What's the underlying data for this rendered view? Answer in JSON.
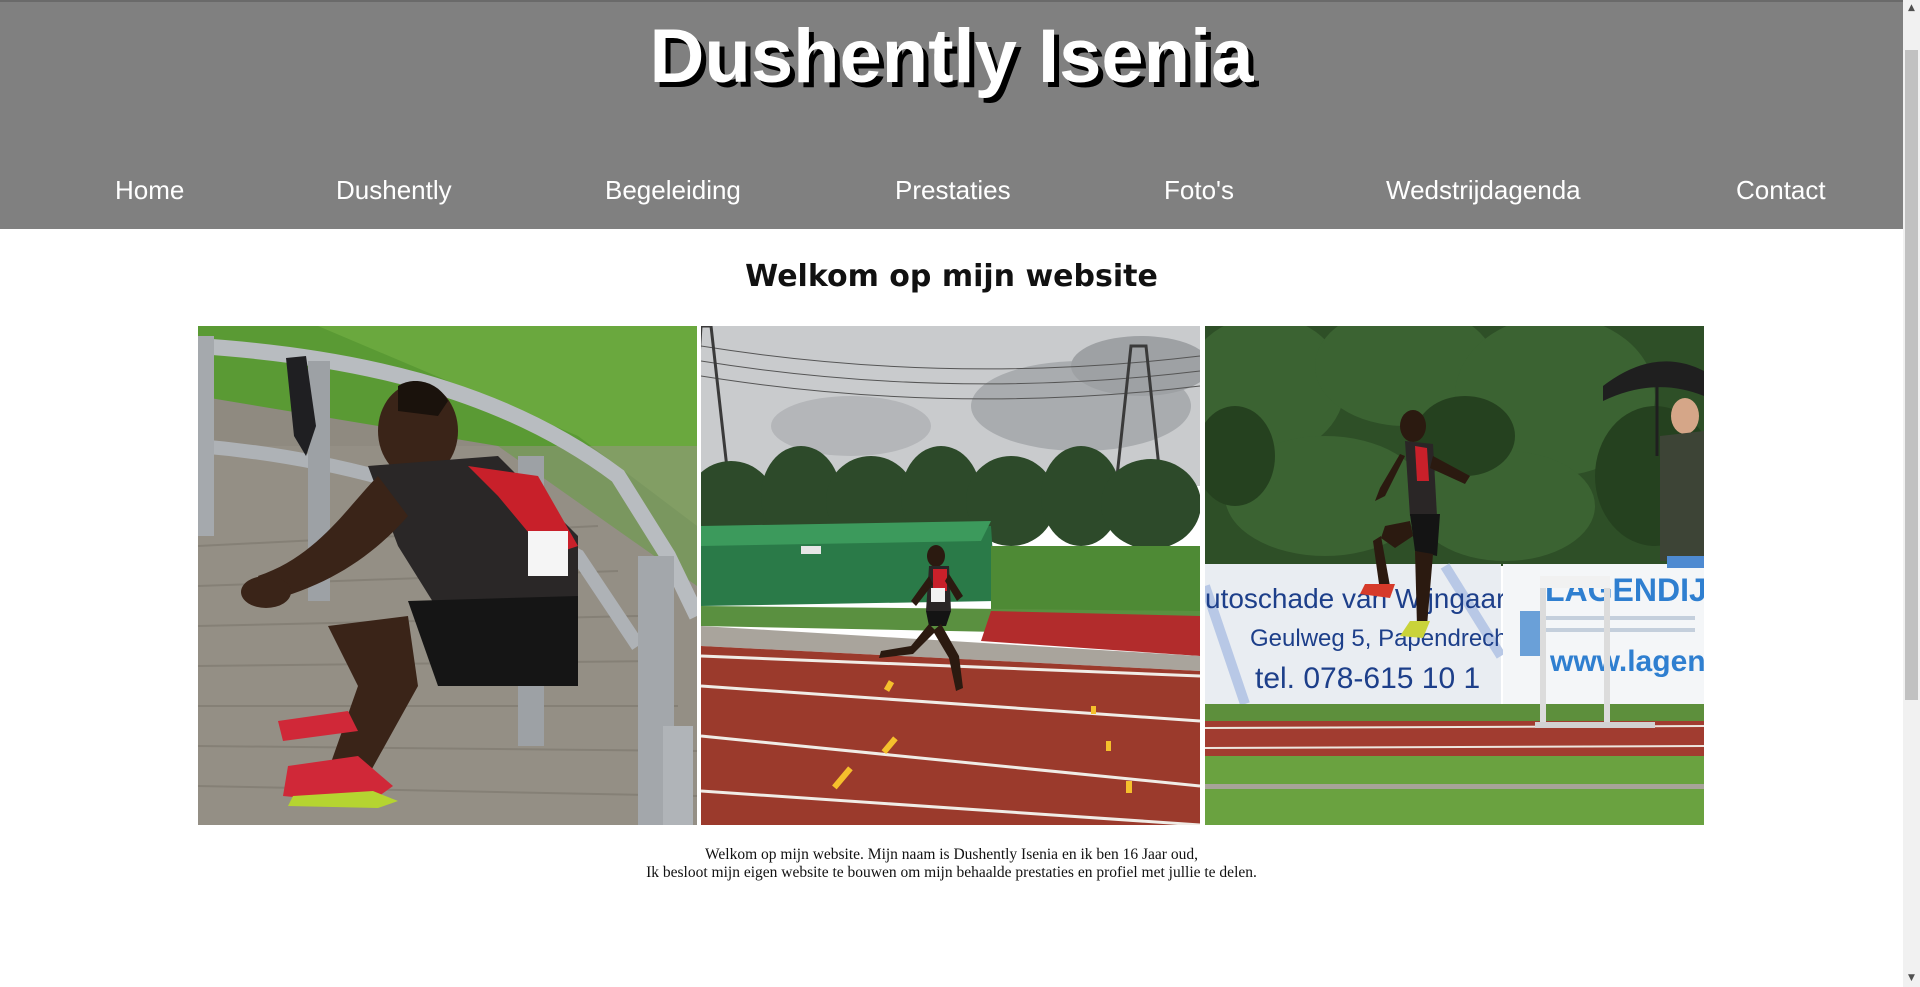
{
  "header": {
    "title": "Dushently Isenia"
  },
  "nav": {
    "items": [
      {
        "label": "Home"
      },
      {
        "label": "Dushently"
      },
      {
        "label": "Begeleiding"
      },
      {
        "label": "Prestaties"
      },
      {
        "label": "Foto's"
      },
      {
        "label": "Wedstrijdagenda"
      },
      {
        "label": "Contact"
      }
    ]
  },
  "main": {
    "heading": "Welkom op mijn website",
    "intro_line1": "Welkom op mijn website. Mijn naam is Dushently Isenia en ik ben 16 Jaar oud,",
    "intro_line2": "Ik besloot mijn eigen website te bouwen om mijn behaalde prestaties en profiel met jullie te delen.",
    "photos": [
      {
        "name": "athlete-resting-photo",
        "banner_text": ""
      },
      {
        "name": "athlete-sprinting-photo",
        "banner_text": ""
      },
      {
        "name": "athlete-hurdles-photo",
        "banner_text_1": "utoschade van Wijngaarden",
        "banner_text_2": "Geulweg 5, Papendrech",
        "banner_text_3": "tel. 078-615 10 1",
        "banner_text_4": "LAGENDIJK SPO",
        "banner_text_5": "www.lagendij"
      }
    ]
  },
  "colors": {
    "header_bg": "#808080",
    "nav_text": "#ffffff",
    "title_shadow": "#000000",
    "track_red": "#9b3a2c",
    "grass_green": "#5c9a38"
  },
  "scrollbar": {
    "up_icon": "triangle-up-icon",
    "down_icon": "triangle-down-icon"
  }
}
